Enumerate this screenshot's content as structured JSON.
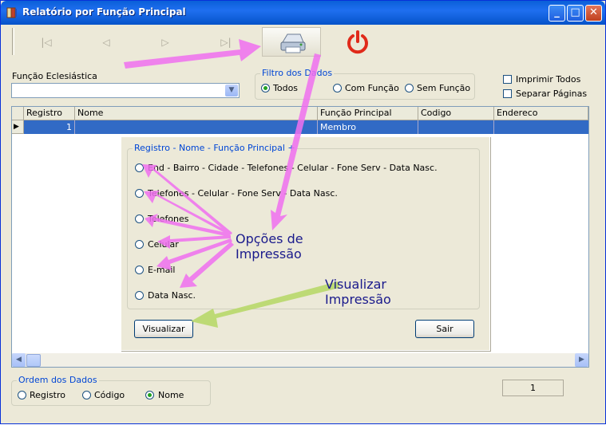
{
  "window": {
    "title": "Relatório por Função Principal",
    "controls": [
      "_",
      "□",
      "✕"
    ]
  },
  "toolbar": {
    "nav": [
      "|◁",
      "◁",
      "▷",
      "▷|"
    ],
    "print_icon": "printer-icon",
    "exit_icon": "power-icon"
  },
  "funcao": {
    "label": "Função Eclesiástica",
    "value": ""
  },
  "filtro": {
    "title": "Filtro dos Dados",
    "options": [
      "Todos",
      "Com Função",
      "Sem Função"
    ],
    "selected": "Todos"
  },
  "opts": {
    "imprimir_todos": "Imprimir Todos",
    "separar_paginas": "Separar Páginas"
  },
  "grid": {
    "columns": [
      "Registro",
      "Nome",
      "Função Principal",
      "Codigo",
      "Endereco"
    ],
    "rows": [
      {
        "registro": "1",
        "nome": "",
        "funcao": "Membro",
        "codigo": "",
        "endereco": ""
      }
    ],
    "row_marker": "▶"
  },
  "dialog": {
    "title": "Registro - Nome - Função Principal  +",
    "options": [
      "End - Bairro - Cidade - Telefones - Celular - Fone Serv - Data Nasc.",
      "Telefones - Celular - Fone Serv - Data Nasc.",
      "Telefones",
      "Celular",
      "E-mail",
      "Data Nasc."
    ],
    "visualizar": "Visualizar",
    "sair": "Sair"
  },
  "callouts": {
    "opcoes": [
      "Opções de",
      "Impressão"
    ],
    "visualizar": [
      "Visualizar",
      "Impressão"
    ]
  },
  "ordem": {
    "title": "Ordem dos Dados",
    "options": [
      "Registro",
      "Código",
      "Nome"
    ],
    "selected": "Nome"
  },
  "status": {
    "count": "1"
  },
  "colors": {
    "accent": "#0046d5",
    "selection": "#316ac5",
    "arrow_pink": "#f070f0",
    "arrow_green": "#b8d86a",
    "callout_text": "#1a1a8c"
  }
}
